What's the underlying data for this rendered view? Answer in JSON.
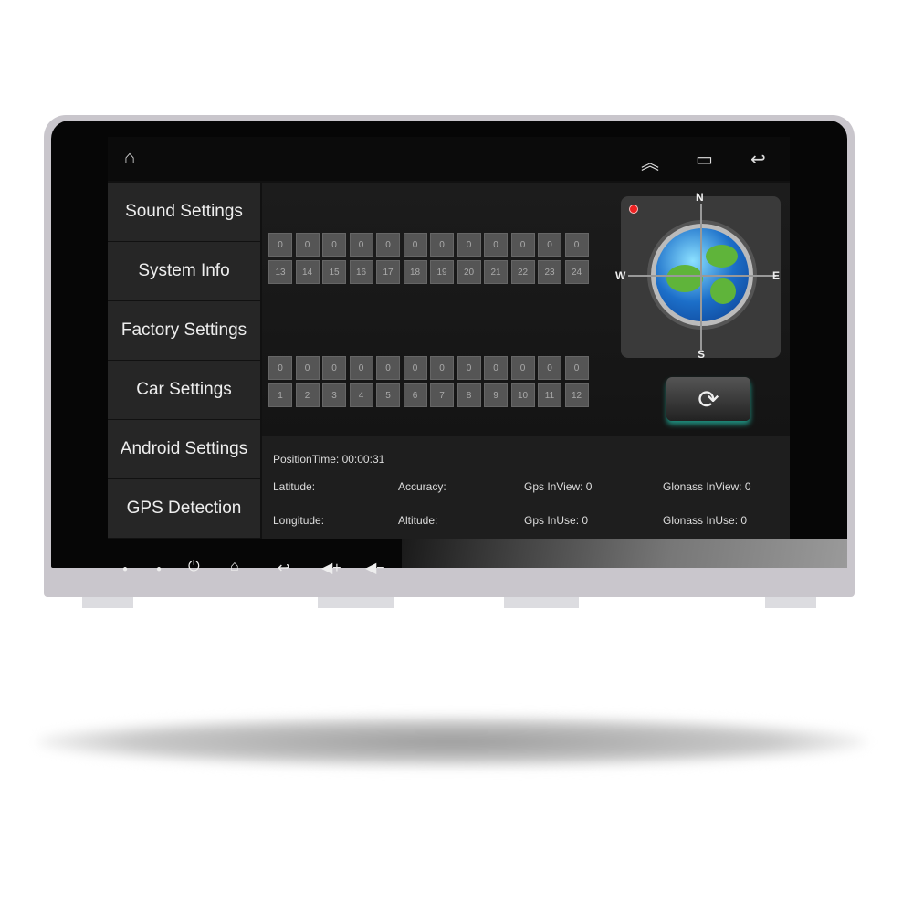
{
  "topbar": {
    "icons": [
      "home-icon",
      "chevron-up-double-icon",
      "recent-apps-icon",
      "back-icon"
    ]
  },
  "sidebar": {
    "items": [
      {
        "label": "Sound Settings"
      },
      {
        "label": "System Info"
      },
      {
        "label": "Factory Settings"
      },
      {
        "label": "Car Settings"
      },
      {
        "label": "Android Settings"
      },
      {
        "label": "GPS Detection"
      }
    ]
  },
  "satellites": {
    "top": {
      "values": [
        "0",
        "0",
        "0",
        "0",
        "0",
        "0",
        "0",
        "0",
        "0",
        "0",
        "0",
        "0"
      ],
      "ids": [
        "13",
        "14",
        "15",
        "16",
        "17",
        "18",
        "19",
        "20",
        "21",
        "22",
        "23",
        "24"
      ]
    },
    "bottom": {
      "values": [
        "0",
        "0",
        "0",
        "0",
        "0",
        "0",
        "0",
        "0",
        "0",
        "0",
        "0",
        "0"
      ],
      "ids": [
        "1",
        "2",
        "3",
        "4",
        "5",
        "6",
        "7",
        "8",
        "9",
        "10",
        "11",
        "12"
      ]
    }
  },
  "compass": {
    "n": "N",
    "s": "S",
    "e": "E",
    "w": "W"
  },
  "info": {
    "position_time": "PositionTime: 00:00:31",
    "latitude": "Latitude:",
    "accuracy": "Accuracy:",
    "gps_inview": "Gps InView: 0",
    "glonass_inview": "Glonass InView: 0",
    "longitude": "Longitude:",
    "altitude": "Altitude:",
    "gps_inuse": "Gps InUse: 0",
    "glonass_inuse": "Glonass InUse: 0"
  },
  "hardware_buttons": [
    "mic-dot",
    "reset-dot",
    "power-icon",
    "home-icon",
    "back-icon",
    "volume-up-icon",
    "volume-down-icon"
  ]
}
